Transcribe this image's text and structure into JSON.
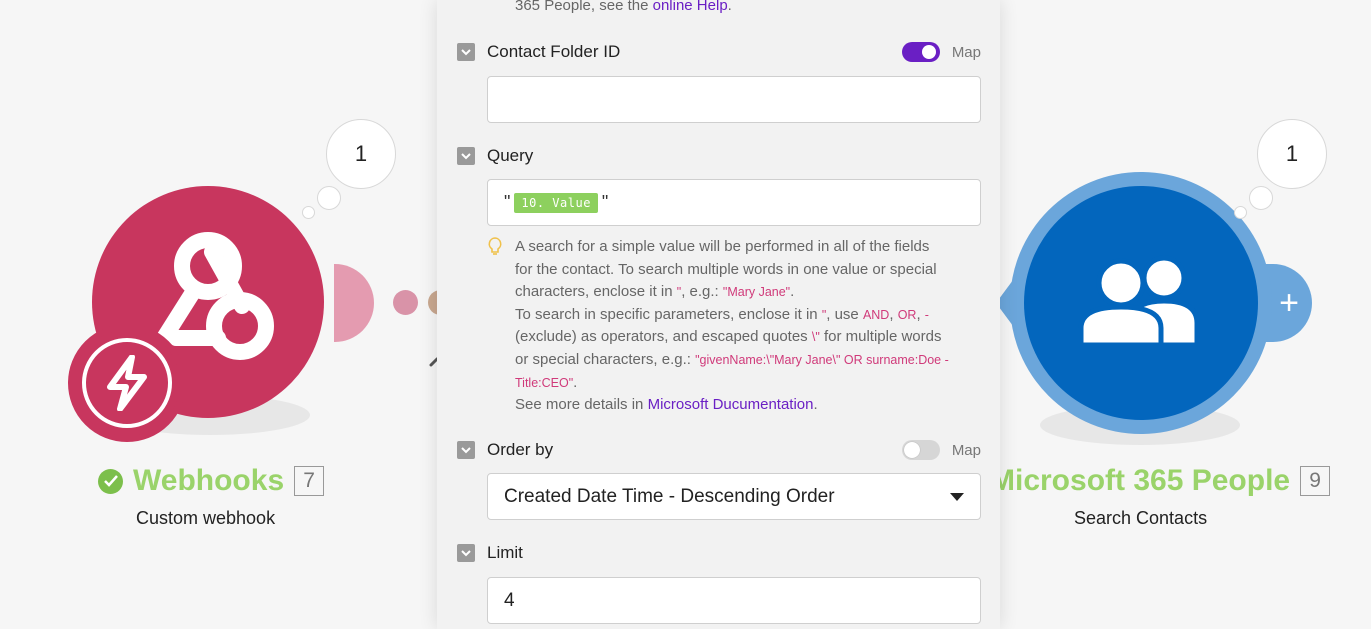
{
  "panel": {
    "top_text_prefix": "365 People, see the ",
    "top_text_link": "online Help",
    "top_text_suffix": ".",
    "fields": {
      "contact_folder": {
        "label": "Contact Folder ID",
        "map_label": "Map",
        "map_on": true,
        "value": ""
      },
      "query": {
        "label": "Query",
        "quote_open": "\"",
        "pill": "10. Value",
        "quote_close": "\"",
        "hint": {
          "l1": "A search for a simple value will be performed in all of the fields",
          "l2": "for the contact. To search multiple words in one value or special",
          "l3a": "characters, enclose it in ",
          "l3b": "\"",
          "l3c": ", e.g.: ",
          "l3d": "\"Mary Jane\"",
          "l3e": ".",
          "l4a": "To search in specific parameters, enclose it in ",
          "l4b": "\"",
          "l4c": ", use ",
          "l4d": "AND",
          "l4e": ", ",
          "l4f": "OR",
          "l4g": ", ",
          "l4h": "-",
          "l5a": "(exclude) as operators, and escaped quotes ",
          "l5b": "\\\"",
          "l5c": " for multiple words",
          "l6a": "or special characters, e.g.: ",
          "l6b": "\"givenName:\\\"Mary Jane\\\" OR surname:Doe -",
          "l7a": "Title:CEO\"",
          "l7b": ".",
          "l8a": "See more details in ",
          "l8b": "Microsoft Ducumentation",
          "l8c": "."
        }
      },
      "order_by": {
        "label": "Order by",
        "map_label": "Map",
        "map_on": false,
        "value": "Created Date Time - Descending Order"
      },
      "limit": {
        "label": "Limit",
        "value": "4"
      }
    }
  },
  "modules": {
    "webhooks": {
      "title": "Webhooks",
      "count": "7",
      "subtitle": "Custom webhook",
      "bubble": "1",
      "color": "#c8365e"
    },
    "microsoft": {
      "title": "Microsoft 365 People",
      "count": "9",
      "subtitle": "Search Contacts",
      "bubble": "1",
      "color": "#0366bd"
    }
  },
  "colors": {
    "accent": "#6a1fc4",
    "title_green": "#9ad36a",
    "pill_green": "#8dd05e"
  }
}
